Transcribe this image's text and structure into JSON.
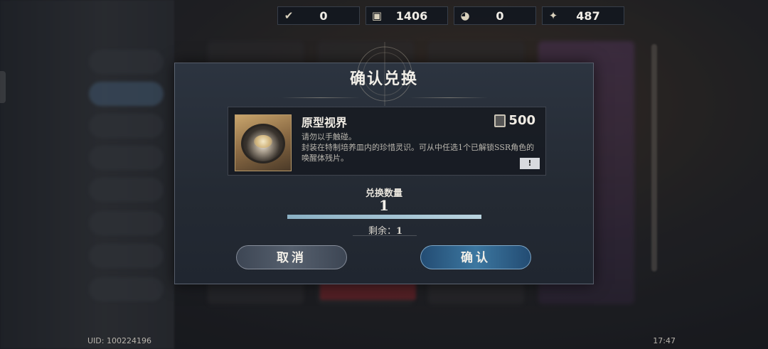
{
  "currencies": [
    {
      "icon": "quill-check-icon",
      "value": "0"
    },
    {
      "icon": "lantern-icon",
      "value": "1406"
    },
    {
      "icon": "orb-icon",
      "value": "0"
    },
    {
      "icon": "crystal-icon",
      "value": "487"
    }
  ],
  "dialog": {
    "title": "确认兑换",
    "item": {
      "name": "原型视界",
      "price": "500",
      "price_icon": "lantern-icon",
      "description": "请勿以手触碰。\n封装在特制培养皿内的珍惜灵识。可从中任选1个已解锁SSR角色的唤醒体残片。",
      "info_button": "!"
    },
    "quantity_label": "兑换数量",
    "quantity_value": "1",
    "quantity_fill": 1.0,
    "remaining_label": "剩余：",
    "remaining_value": "1",
    "cancel_label": "取消",
    "confirm_label": "确认"
  },
  "footer": {
    "uid": "UID: 100224196",
    "clock": "17:47"
  },
  "colors": {
    "accent_confirm": "#3c77a0",
    "dialog_bg": "#2c3440"
  }
}
